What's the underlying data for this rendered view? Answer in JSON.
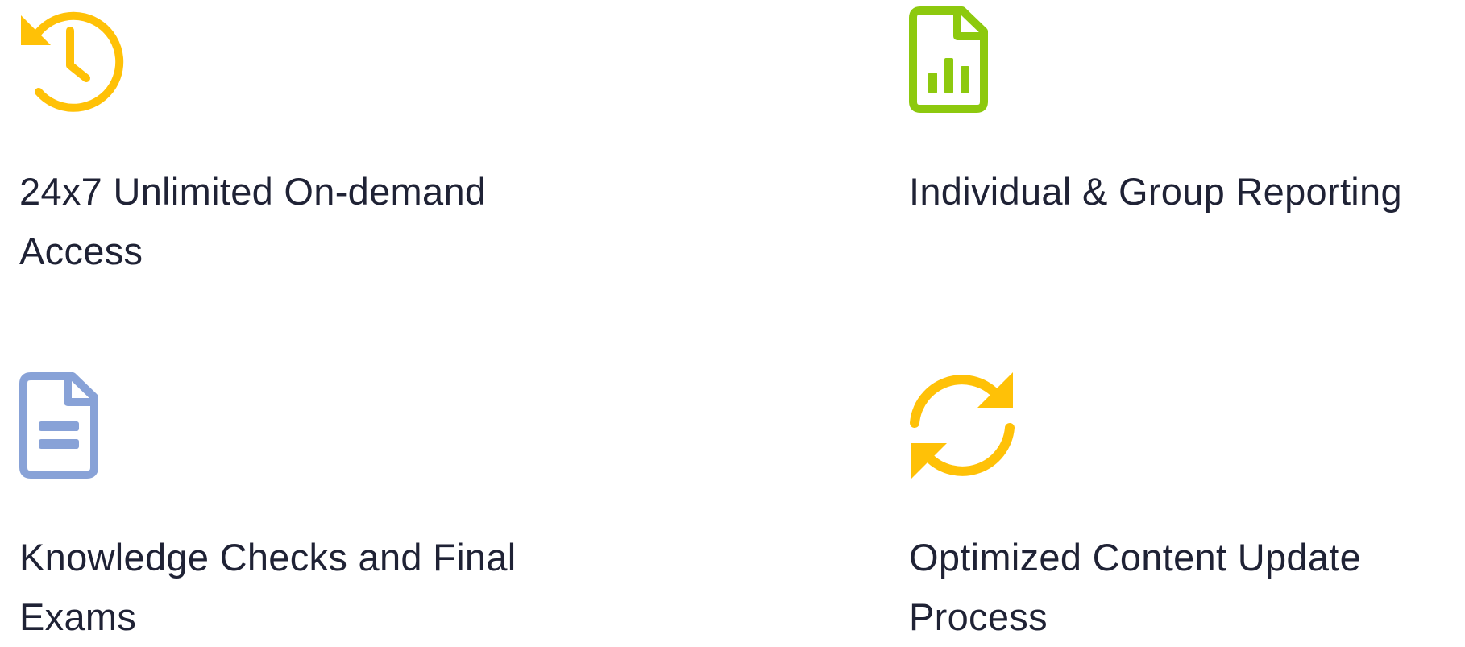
{
  "features": [
    {
      "icon": "history-clock-icon",
      "color": "#FFC107",
      "label": "24x7 Unlimited On-demand Access"
    },
    {
      "icon": "bar-chart-document-icon",
      "color": "#8DC90E",
      "label": "Individual & Group Reporting"
    },
    {
      "icon": "document-icon",
      "color": "#88A2D7",
      "label": "Knowledge Checks and Final Exams"
    },
    {
      "icon": "sync-arrows-icon",
      "color": "#FFC107",
      "label": "Optimized Content Update Process"
    }
  ]
}
